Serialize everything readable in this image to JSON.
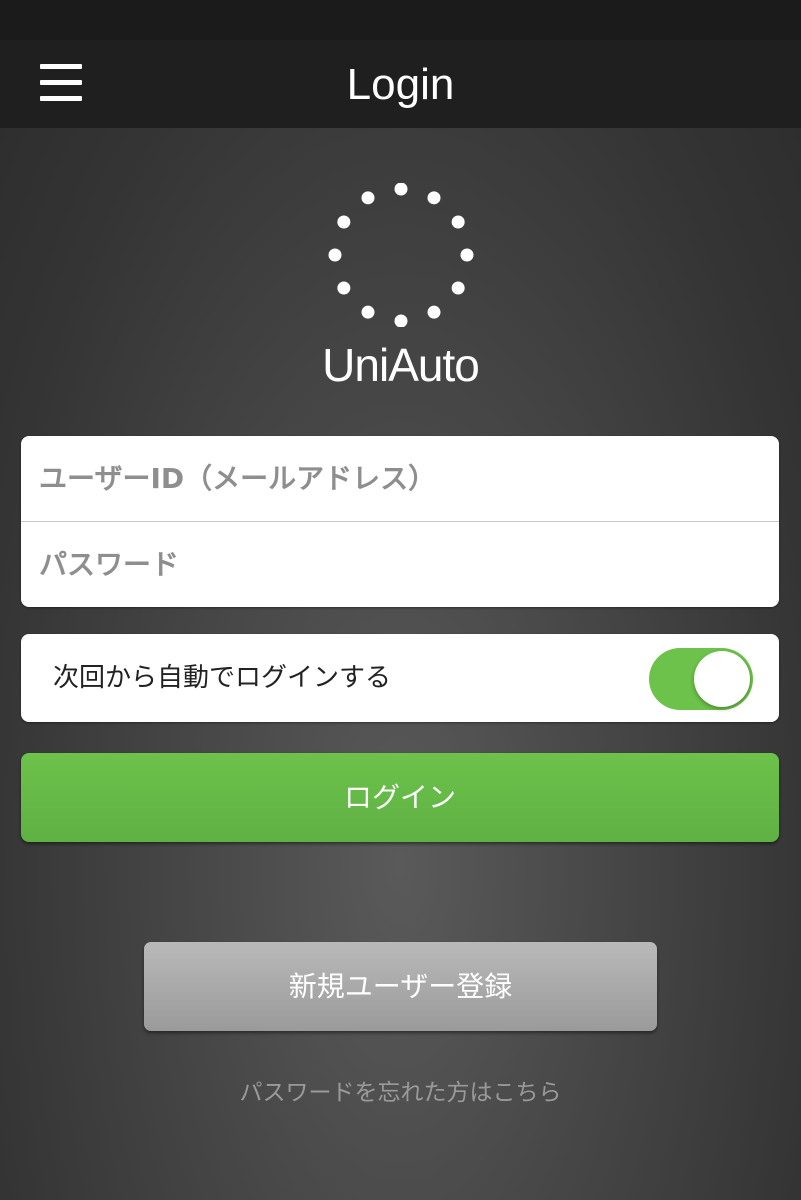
{
  "nav": {
    "title": "Login",
    "menu_icon": "hamburger-menu-icon"
  },
  "logo": {
    "mark_icon": "dot-ring-logo-icon",
    "text": "UniAuto"
  },
  "form": {
    "user_id_placeholder": "ユーザーID（メールアドレス）",
    "user_id_value": "",
    "password_placeholder": "パスワード",
    "password_value": ""
  },
  "auto_login": {
    "label": "次回から自動でログインする",
    "enabled": true
  },
  "login_button": {
    "label": "ログイン"
  },
  "register_button": {
    "label": "新規ユーザー登録"
  },
  "forgot_link": {
    "label": "パスワードを忘れた方はこちら"
  },
  "colors": {
    "accent_green": "#6cc24a",
    "nav_background": "#1f1f1f",
    "register_gray": "#a8a8a8"
  }
}
